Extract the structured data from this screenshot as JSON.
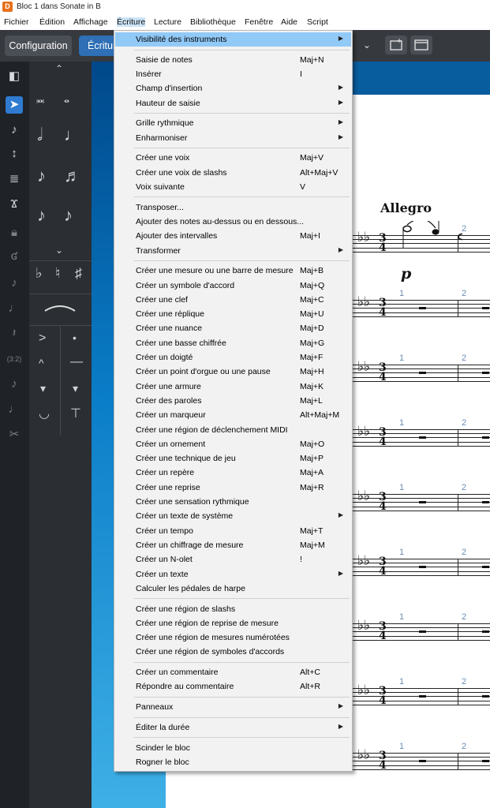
{
  "window": {
    "title": "Bloc 1 dans Sonate in B",
    "app_icon_letter": "D"
  },
  "menubar": [
    "Fichier",
    "Édition",
    "Affichage",
    "Écriture",
    "Lecture",
    "Bibliothèque",
    "Fenêtre",
    "Aide",
    "Script"
  ],
  "toolbar": {
    "tab_config": "Configuration",
    "tab_ecriture": "Écriture"
  },
  "score": {
    "tempo": "Allegro",
    "dynamic": "p",
    "time_sig_top": "3",
    "time_sig_bottom": "4",
    "bar_numbers": [
      "1",
      "2"
    ]
  },
  "icons": {
    "rail": [
      "panel-toggle-icon",
      "select-arrow-icon",
      "note-input-icon",
      "insert-icon",
      "tuplet-icon",
      "chord-icon",
      "lock-icon",
      "tie-icon",
      "add-note-icon",
      "dotted-note-icon",
      "rest-icon",
      "tuplet-32-icon",
      "grace-note-icon",
      "slash-icon",
      "scissors-icon"
    ]
  },
  "menu": {
    "items": [
      {
        "label": "Visibilité des instruments",
        "shortcut": "",
        "submenu": true
      },
      {
        "label": "Saisie de notes",
        "shortcut": "Maj+N",
        "submenu": false
      },
      {
        "label": "Insérer",
        "shortcut": "I",
        "submenu": false
      },
      {
        "label": "Champ d'insertion",
        "shortcut": "",
        "submenu": true
      },
      {
        "label": "Hauteur de saisie",
        "shortcut": "",
        "submenu": true
      },
      {
        "label": "Grille rythmique",
        "shortcut": "",
        "submenu": true
      },
      {
        "label": "Enharmoniser",
        "shortcut": "",
        "submenu": true
      },
      {
        "label": "Créer une voix",
        "shortcut": "Maj+V",
        "submenu": false
      },
      {
        "label": "Créer une voix de slashs",
        "shortcut": "Alt+Maj+V",
        "submenu": false
      },
      {
        "label": "Voix suivante",
        "shortcut": "V",
        "submenu": false
      },
      {
        "label": "Transposer...",
        "shortcut": "",
        "submenu": false
      },
      {
        "label": "Ajouter des notes au-dessus ou en dessous...",
        "shortcut": "",
        "submenu": false
      },
      {
        "label": "Ajouter des intervalles",
        "shortcut": "Maj+I",
        "submenu": false
      },
      {
        "label": "Transformer",
        "shortcut": "",
        "submenu": true
      },
      {
        "label": "Créer une mesure ou une barre de mesure",
        "shortcut": "Maj+B",
        "submenu": false
      },
      {
        "label": "Créer un symbole d'accord",
        "shortcut": "Maj+Q",
        "submenu": false
      },
      {
        "label": "Créer une clef",
        "shortcut": "Maj+C",
        "submenu": false
      },
      {
        "label": "Créer une réplique",
        "shortcut": "Maj+U",
        "submenu": false
      },
      {
        "label": "Créer une nuance",
        "shortcut": "Maj+D",
        "submenu": false
      },
      {
        "label": "Créer une basse chiffrée",
        "shortcut": "Maj+G",
        "submenu": false
      },
      {
        "label": "Créer un doigté",
        "shortcut": "Maj+F",
        "submenu": false
      },
      {
        "label": "Créer un point d'orgue ou une pause",
        "shortcut": "Maj+H",
        "submenu": false
      },
      {
        "label": "Créer une armure",
        "shortcut": "Maj+K",
        "submenu": false
      },
      {
        "label": "Créer des paroles",
        "shortcut": "Maj+L",
        "submenu": false
      },
      {
        "label": "Créer un marqueur",
        "shortcut": "Alt+Maj+M",
        "submenu": false
      },
      {
        "label": "Créer une région de déclenchement MIDI",
        "shortcut": "",
        "submenu": false
      },
      {
        "label": "Créer un ornement",
        "shortcut": "Maj+O",
        "submenu": false
      },
      {
        "label": "Créer une technique de jeu",
        "shortcut": "Maj+P",
        "submenu": false
      },
      {
        "label": "Créer un repère",
        "shortcut": "Maj+A",
        "submenu": false
      },
      {
        "label": "Créer une reprise",
        "shortcut": "Maj+R",
        "submenu": false
      },
      {
        "label": "Créer une sensation rythmique",
        "shortcut": "",
        "submenu": false
      },
      {
        "label": "Créer un texte de système",
        "shortcut": "",
        "submenu": true
      },
      {
        "label": "Créer un tempo",
        "shortcut": "Maj+T",
        "submenu": false
      },
      {
        "label": "Créer un chiffrage de mesure",
        "shortcut": "Maj+M",
        "submenu": false
      },
      {
        "label": "Créer un N-olet",
        "shortcut": "!",
        "submenu": false
      },
      {
        "label": "Créer un texte",
        "shortcut": "",
        "submenu": true
      },
      {
        "label": "Calculer les pédales de harpe",
        "shortcut": "",
        "submenu": false
      },
      {
        "label": "Créer une région de slashs",
        "shortcut": "",
        "submenu": false
      },
      {
        "label": "Créer une région de reprise de mesure",
        "shortcut": "",
        "submenu": false
      },
      {
        "label": "Créer une région de mesures numérotées",
        "shortcut": "",
        "submenu": false
      },
      {
        "label": "Créer une région de symboles d'accords",
        "shortcut": "",
        "submenu": false
      },
      {
        "label": "Créer un commentaire",
        "shortcut": "Alt+C",
        "submenu": false
      },
      {
        "label": "Répondre au commentaire",
        "shortcut": "Alt+R",
        "submenu": false
      },
      {
        "label": "Panneaux",
        "shortcut": "",
        "submenu": true
      },
      {
        "label": "Éditer la durée",
        "shortcut": "",
        "submenu": true
      },
      {
        "label": "Scinder le bloc",
        "shortcut": "",
        "submenu": false
      },
      {
        "label": "Rogner le bloc",
        "shortcut": "",
        "submenu": false
      }
    ]
  }
}
